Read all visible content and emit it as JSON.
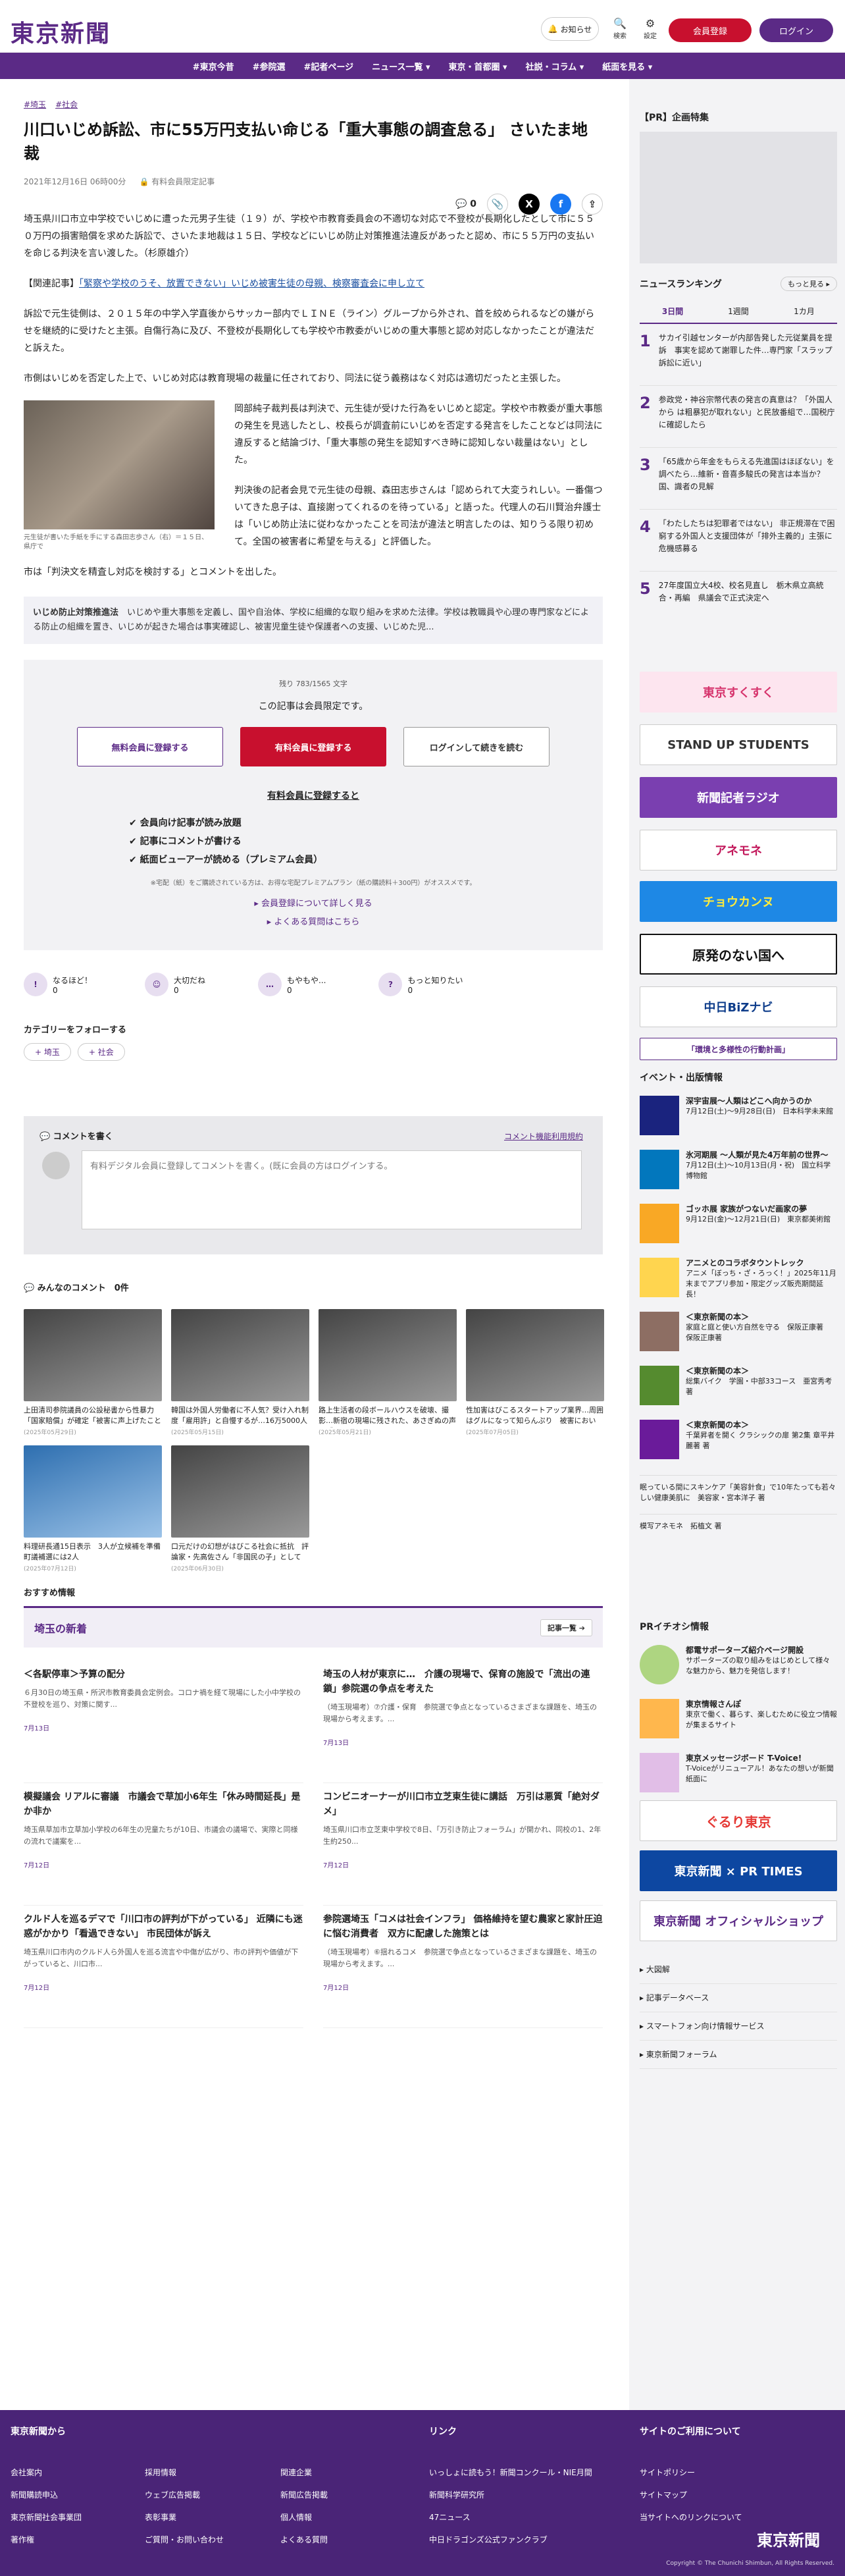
{
  "header": {
    "logo": "東京新聞",
    "notify": "お知らせ",
    "search": "検索",
    "settings": "設定",
    "register": "会員登録",
    "login": "ログイン"
  },
  "nav": [
    "#東京今昔",
    "#参院選",
    "#記者ページ",
    "ニュース一覧 ▾",
    "東京・首都圏 ▾",
    "社説・コラム ▾",
    "紙面を見る ▾"
  ],
  "article": {
    "tags": [
      "#埼玉",
      "#社会"
    ],
    "title": "川口いじめ訴訟、市に55万円支払い命じる「重大事態の調査怠る」 さいたま地裁",
    "date": "2021年12月16日 06時00分",
    "member": "有料会員限定記事",
    "comments": "0",
    "p1": "埼玉県川口市立中学校でいじめに遭った元男子生徒（１９）が、学校や市教育委員会の不適切な対応で不登校が長期化したとして市に５５０万円の損害賠償を求めた訴訟で、さいたま地裁は１５日、学校などにいじめ防止対策推進法違反があったと認め、市に５５万円の支払いを命じる判決を言い渡した。（杉原雄介）",
    "related_prefix": "【関連記事】",
    "related_link": "「緊察や学校のうそ、放置できない」いじめ被害生徒の母親、検察審査会に申し立て",
    "p2": "訴訟で元生徒側は、２０１５年の中学入学直後からサッカー部内でＬＩＮＥ（ライン）グループから外され、首を絞められるなどの嫌がらせを継続的に受けたと主張。自傷行為に及び、不登校が長期化しても学校や市教委がいじめの重大事態と認め対応しなかったことが違法だと訴えた。",
    "p3": "市側はいじめを否定した上で、いじめ対応は教育現場の裁量に任されており、同法に従う義務はなく対応は適切だったと主張した。",
    "p4": "岡部純子裁判長は判決で、元生徒が受けた行為をいじめと認定。学校や市教委が重大事態の発生を見逃したとし、校長らが調査前にいじめを否定する発言をしたことなどは同法に違反すると結論づけ、「重大事態の発生を認知すべき時に認知しない裁量はない」とした。",
    "p5": "判決後の記者会見で元生徒の母親、森田志歩さんは「認められて大変うれしい。一番傷ついてきた息子は、直接謝ってくれるのを待っている」と語った。代理人の石川賢治弁護士は「いじめ防止法に従わなかったことを司法が違法と明言したのは、知りうる限り初めて。全国の被害者に希望を与える」と評価した。",
    "p6": "市は「判決文を精査し対応を検討する」とコメントを出した。",
    "caption": "元生徒が書いた手紙を手にする森田志歩さん（右）＝１５日、県庁で",
    "lede_title": "いじめ防止対策推進法",
    "lede": "いじめや重大事態を定義し、国や自治体、学校に組織的な取り組みを求めた法律。学校は教職員や心理の専門家などによる防止の組織を置き、いじめが起きた場合は事実確認し、被害児童生徒や保護者への支援、いじめた児..."
  },
  "paywall": {
    "count": "残り 783/1565 文字",
    "limited": "この記事は会員限定です。",
    "free": "無料会員に登録する",
    "paid": "有料会員に登録する",
    "login": "ログインして続きを読む",
    "benefit_title": "有料会員に登録すると",
    "benefits": [
      "✔ 会員向け記事が読み放題",
      "✔ 記事にコメントが書ける",
      "✔ 紙面ビューアーが読める（プレミアム会員）"
    ],
    "note": "※宅配（紙）をご購読されている方は、お得な宅配プレミアムプラン（紙の購読料＋300円）がオススメです。",
    "link1": "▸ 会員登録について詳しく見る",
    "link2": "▸ よくある質問はこちら"
  },
  "reactions": [
    {
      "icon": "!",
      "label": "なるほど！",
      "n": "0"
    },
    {
      "icon": "☺",
      "label": "大切だね",
      "n": "0"
    },
    {
      "icon": "…",
      "label": "もやもや...",
      "n": "0"
    },
    {
      "icon": "?",
      "label": "もっと知りたい",
      "n": "0"
    }
  ],
  "follow": {
    "title": "カテゴリーをフォローする",
    "chips": [
      "+ 埼玉",
      "+ 社会"
    ]
  },
  "comment": {
    "title": "コメントを書く",
    "rule": "コメント機能利用規約",
    "placeholder": "有料デジタル会員に登録してコメントを書く。(既に会員の方はログインする。"
  },
  "all_comments": "みんなのコメント　0件",
  "cards": [
    {
      "t": "上田清司参院議員の公設秘書から性暴力「国家賠償」が確定「被害に声上げたことから...",
      "d": "(2025年05月29日)"
    },
    {
      "t": "韓国は外国人労働者に不人気？受け入れ制度「雇用許」と自慢するが…16万5000人の枠が半...",
      "d": "(2025年05月15日)"
    },
    {
      "t": "路上生活者の段ボールハウスを破壊、撮影…新宿の現場に残された、あさぎぬの声と「やり...",
      "d": "(2025年05月21日)"
    },
    {
      "t": "性加害はびこるスタートアップ業界…周囲はグルになって知らんぷり　被害において、改善へ...",
      "d": "(2025年07月05日)"
    },
    {
      "t": "料理研長通15日表示　3人が立候補を準備　町議補選には2人",
      "d": "(2025年07月12日)"
    },
    {
      "t": "口元だけの幻想がはびこる社会に抵抗　評論家・先高佐さん「非国民の子」として　利益...",
      "d": "(2025年06月30日)"
    }
  ],
  "recommend": "おすすめ情報",
  "saitama": {
    "title": "埼玉の新着",
    "more": "記事一覧 ➔",
    "items": [
      {
        "t": "＜各駅停車＞予算の配分",
        "b": "６月30日の埼玉県・所沢市教育委員会定例会。コロナ禍を経て現場にした小中学校の不登校を巡り、対策に関す...",
        "d": "7月13日"
      },
      {
        "t": "埼玉の人材が東京に…　介護の現場で、保育の施設で「流出の連鎖」参院選の争点を考えた",
        "b": "（埼玉現場考）⑦介護・保育　参院選で争点となっているさまざまな課題を、埼玉の現場から考えます。...",
        "d": "7月13日"
      },
      {
        "t": "模擬議会 リアルに審議　市議会で草加小6年生「休み時間延長」是か非か",
        "b": "埼玉県草加市立草加小学校の6年生の児童たちが10日、市議会の議場で、実際と同様の流れで議案を...",
        "d": "7月12日"
      },
      {
        "t": "コンビニオーナーが川口市立芝東生徒に講話　万引は悪質「絶対ダメ」",
        "b": "埼玉県川口市立芝東中学校で8日、「万引き防止フォーラム」が開かれ、同校の1、2年生約250...",
        "d": "7月12日"
      },
      {
        "t": "クルド人を巡るデマで「川口市の評判が下がっている」 近隣にも迷惑がかかり「看過できない」 市民団体が訴え",
        "b": "埼玉県川口市内のクルド人ら外国人を巡る流言や中傷が広がり、市の評判や価値が下がっていると、川口市...",
        "d": "7月12日"
      },
      {
        "t": "参院選埼玉「コメは社会インフラ」 価格維持を望む農家と家計圧迫に悩む消費者　双方に配慮した施策とは",
        "b": "（埼玉現場考）⑥揺れるコメ　参院選で争点となっているさまざまな課題を、埼玉の現場から考えます。...",
        "d": "7月12日"
      }
    ]
  },
  "side": {
    "pr": "【PR】企画特集",
    "ranking": {
      "title": "ニュースランキング",
      "more": "もっと見る ▸",
      "tabs": [
        "3日間",
        "1週間",
        "1カ月"
      ],
      "items": [
        {
          "n": "1",
          "t": "サカイ引越センターが内部告発した元従業員を提訴　事実を認めて謝罪した件…専門家「スラップ訴訟に近い」"
        },
        {
          "n": "2",
          "t": "参政党・神谷宗幣代表の発言の真意は？「外国人から は粗暴犯が取れない」と民放番組で…国税庁に確認したら"
        },
        {
          "n": "3",
          "t": "「65歳から年金をもらえる先進国はほぼない」を調べたら…維新・音喜多駿氏の発言は本当か？国、識者の見解"
        },
        {
          "n": "4",
          "t": "「わたしたちは犯罪者ではない」 非正規滞在で困窮する外国人と支援団体が「排外主義的」主張に危機感募る"
        },
        {
          "n": "5",
          "t": "27年度国立大4校、校名見直し　栃木県立高統合・再編　県議会で正式決定へ"
        }
      ]
    },
    "banners": [
      "東京すくすく",
      "STAND UP STUDENTS",
      "新聞記者ラジオ",
      "アネモネ",
      "チョウカンヌ",
      "原発のない国へ",
      "中日BiZナビ",
      "「環境と多様性の行動計画」"
    ],
    "events": {
      "title": "イベント・出版情報",
      "items": [
        {
          "h": "深宇宙展〜人類はどこへ向かうのか",
          "d": "7月12日(土)〜9月28日(日)　日本科学未来館"
        },
        {
          "h": "氷河期展 〜人類が見た4万年前の世界〜",
          "d": "7月12日(土)〜10月13日(月・祝)　国立科学博物館"
        },
        {
          "h": "ゴッホ展 家族がつないだ画家の夢",
          "d": "9月12日(金)〜12月21日(日)　東京都美術館"
        },
        {
          "h": "アニメとのコラボタウントレック",
          "d": "アニメ「ぼっち・ざ・ろっく！」2025年11月末までアプリ参加・限定グッズ販売期間延長！"
        },
        {
          "h": "＜東京新聞の本＞",
          "d": "家庭と庭と使い方自然を守る　保阪正康著　保阪正康著"
        },
        {
          "h": "＜東京新聞の本＞",
          "d": "総集バイク　学園・中部33コース　亜宮秀考 著"
        },
        {
          "h": "＜東京新聞の本＞",
          "d": "千葉昇者を開く クラシックの扉 第2集 章平井麗著 著"
        }
      ],
      "extra1": "眠っている間にスキンケア「美容針食」で10年たっても若々しい健康美肌に　美容家・宮本洋子 著",
      "extra2": "模写アネモネ　拓植文 著"
    },
    "pr2": {
      "title": "PRイチオシ情報",
      "items": [
        {
          "h": "都電サポーターズ紹介ページ開設",
          "d": "サポーターズの取り組みをはじめとして様々な魅力から、魅力を発信します！"
        },
        {
          "h": "東京情報さんぽ",
          "d": "東京で働く、暮らす、楽しむために役立つ情報が集まるサイト"
        },
        {
          "h": "東京メッセージボード T-Voice!",
          "d": "T-Voiceがリニューアル！あなたの想いが新聞紙面に"
        }
      ]
    },
    "banners2": [
      "ぐるり東京",
      "東京新聞 × PR TIMES",
      "東京新聞 オフィシャルショップ"
    ],
    "links": [
      "▸ 大図解",
      "▸ 記事データベース",
      "▸ スマートフォン向け情報サービス",
      "▸ 東京新聞フォーラム"
    ]
  },
  "footer": {
    "c1": "東京新聞から",
    "c2": "リンク",
    "c3": "サイトのご利用について",
    "l1": [
      "会社案内",
      "新聞購読申込",
      "東京新聞社会事業団",
      "著作権"
    ],
    "l2": [
      "採用情報",
      "ウェブ広告掲載",
      "表彰事業",
      "ご質問・お問い合わせ"
    ],
    "l3": [
      "関連企業",
      "新聞広告掲載",
      "個人情報",
      "よくある質問"
    ],
    "l4": [
      "いっしょに読もう！新聞コンクール・NIE月間",
      "新聞科学研究所",
      "47ニュース",
      "中日ドラゴンズ公式ファンクラブ"
    ],
    "l5": [
      "サイトポリシー",
      "サイトマップ",
      "当サイトへのリンクについて"
    ],
    "logo": "東京新聞",
    "copy": "Copyright © The Chunichi Shimbun, All Rights Reserved."
  }
}
